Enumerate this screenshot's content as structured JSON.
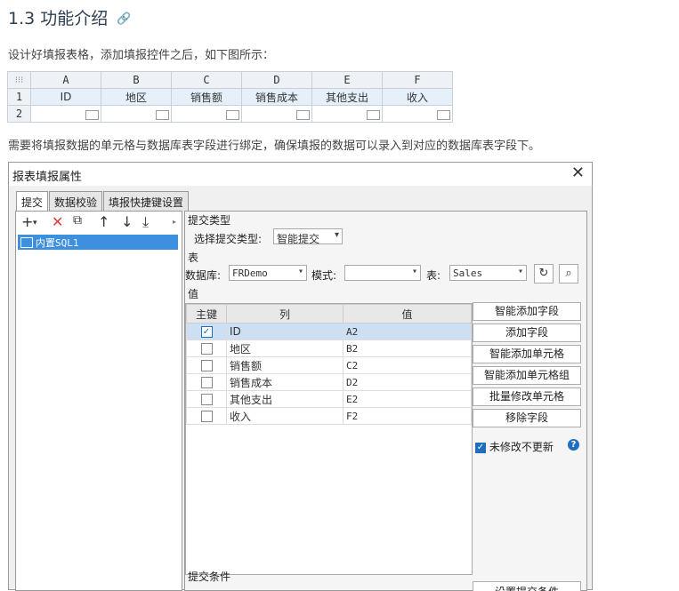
{
  "heading": {
    "title": "1.3 功能介绍",
    "anchor_icon": "link-icon"
  },
  "intro_text": "设计好填报表格，添加填报控件之后，如下图所示：",
  "sheet": {
    "columns": [
      "A",
      "B",
      "C",
      "D",
      "E",
      "F"
    ],
    "row_numbers": [
      "1",
      "2"
    ],
    "row1": [
      "ID",
      "地区",
      "销售额",
      "销售成本",
      "其他支出",
      "收入"
    ]
  },
  "bind_text": "需要将填报数据的单元格与数据库表字段进行绑定，确保填报的数据可以录入到对应的数据库表字段下。",
  "dialog": {
    "title": "报表填报属性",
    "close": "✕",
    "tabs": [
      "提交",
      "数据校验",
      "填报快捷键设置"
    ],
    "tree_item": "内置SQL1",
    "submit_type_group": "提交类型",
    "submit_type_label": "选择提交类型:",
    "submit_type_value": "智能提交",
    "table_group": "表",
    "db_label": "数据库:",
    "db_value": "FRDemo",
    "schema_label": "模式:",
    "schema_value": "",
    "table_label": "表:",
    "table_value": "Sales",
    "value_group": "值",
    "grid_headers": [
      "主键",
      "列",
      "值"
    ],
    "rows": [
      {
        "pk": true,
        "column": "ID",
        "value": "A2"
      },
      {
        "pk": false,
        "column": "地区",
        "value": "B2"
      },
      {
        "pk": false,
        "column": "销售额",
        "value": "C2"
      },
      {
        "pk": false,
        "column": "销售成本",
        "value": "D2"
      },
      {
        "pk": false,
        "column": "其他支出",
        "value": "E2"
      },
      {
        "pk": false,
        "column": "收入",
        "value": "F2"
      }
    ],
    "buttons": [
      "智能添加字段",
      "添加字段",
      "智能添加单元格",
      "智能添加单元格组",
      "批量修改单元格",
      "移除字段"
    ],
    "no_update_label": "未修改不更新",
    "condition_group": "提交条件",
    "condition_button": "设置提交条件"
  }
}
